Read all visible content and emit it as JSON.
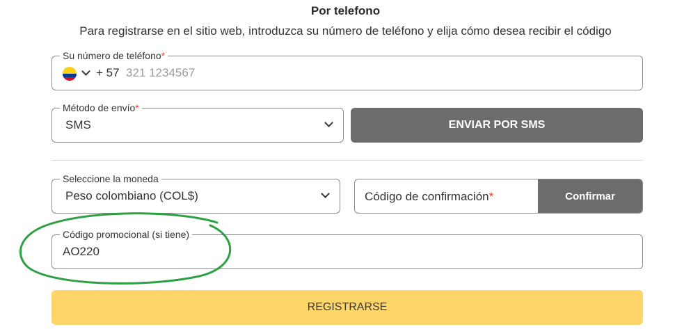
{
  "header": {
    "title": "Por telefono",
    "subtitle": "Para registrarse en el sitio web, introduzca su número de teléfono y elija cómo desea recibir el código"
  },
  "phone": {
    "label": "Su número de teléfono",
    "required_mark": "*",
    "country_flag": "colombia-flag-icon",
    "dial_code": "+ 57",
    "placeholder": "321 1234567",
    "value": ""
  },
  "send_method": {
    "label": "Método de envío",
    "required_mark": "*",
    "selected": "SMS"
  },
  "send_button": {
    "label": "ENVIAR POR SMS"
  },
  "currency": {
    "label": "Seleccione la moneda",
    "selected": "Peso colombiano (COL$)"
  },
  "confirmation": {
    "label": "Código de confirmación",
    "required_mark": "*",
    "button_label": "Confirmar"
  },
  "promo": {
    "label": "Código promocional (si tiene)",
    "value": "AO220"
  },
  "register_button": {
    "label": "REGISTRARSE"
  },
  "colors": {
    "gray_button": "#6c6c6c",
    "register_yellow": "#fdd568",
    "required_red": "#e53935",
    "highlight_green": "#2ea043"
  }
}
